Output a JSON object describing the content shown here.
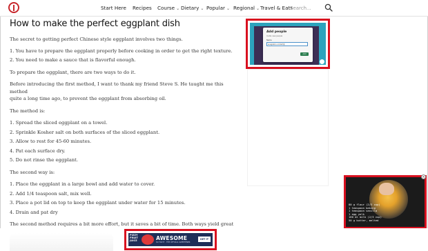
{
  "nav": {
    "logo": "site-logo",
    "items": [
      {
        "label": "Start Here",
        "has_dropdown": false
      },
      {
        "label": "Recipes",
        "has_dropdown": false
      },
      {
        "label": "Course",
        "has_dropdown": true
      },
      {
        "label": "Dietary",
        "has_dropdown": true
      },
      {
        "label": "Popular",
        "has_dropdown": true
      },
      {
        "label": "Regional",
        "has_dropdown": true
      },
      {
        "label": "Travel & Eats",
        "has_dropdown": false
      }
    ],
    "search_placeholder": "Search...",
    "search_icon": "search-icon",
    "chevron": "⌄"
  },
  "article": {
    "title": "How to make the perfect eggplant dish",
    "intro": "The secret to getting perfect Chinese style eggplant involves two things.",
    "things": [
      "1. You have to prepare the eggplant properly before cooking in order to get the right texture.",
      "2. You need to make a sauce that is flavorful enough."
    ],
    "prepare": "To prepare the eggplant, there are two ways to do it.",
    "before_1": "Before introducing the first method, I want to thank my friend Steve S. He taught me this method",
    "before_2": "quite a long time ago, to prevent the eggplant from absorbing oil.",
    "method_label": "The method is:",
    "method_steps": [
      "1. Spread the sliced eggplant on a towel.",
      "2. Sprinkle Kosher salt on both surfaces of the sliced eggplant.",
      "3. Allow to rest for 45-60 minutes.",
      "4. Pat each surface dry.",
      "5. Do not rinse the eggplant."
    ],
    "second_label": "The second way is:",
    "second_steps": [
      "1. Place the eggplant in a large bowl and add water to cover.",
      "2. Add 1/4 teaspoon salt, mix well.",
      "3. Place a pot lid on top to keep the eggplant under water for 15 minutes.",
      "4. Drain and pat dry"
    ],
    "closing": "The second method requires a bit more effort, but it saves a bit of time. Both ways yield great results."
  },
  "ads": {
    "top": {
      "dialog_title": "Add people",
      "dialog_subtitle": "Invite new people",
      "name_label": "Name",
      "input_value": "anagoston.contact@",
      "button_label": "Add"
    },
    "video": {
      "recipe_lines": [
        "80 g flour (2/3 cup)",
        "1 teaspoon baking",
        "1 teaspoon vanilla",
        "1 egg yolk",
        "160 ml milk (2/3 cup)",
        "50 g butter, melted"
      ],
      "close_icon": "×"
    },
    "bottom": {
      "brand": "FIZZY FRUIT JUICE",
      "headline": "AWESOME",
      "small_print": "SO TASTY · THE OFFICIAL SWEETENER",
      "cta": "GET IT"
    }
  },
  "colors": {
    "ad_highlight": "#d8101f",
    "brand_red": "#c8262b",
    "ad_teal": "#2ca3bd",
    "ad_navy": "#1e2e58"
  }
}
